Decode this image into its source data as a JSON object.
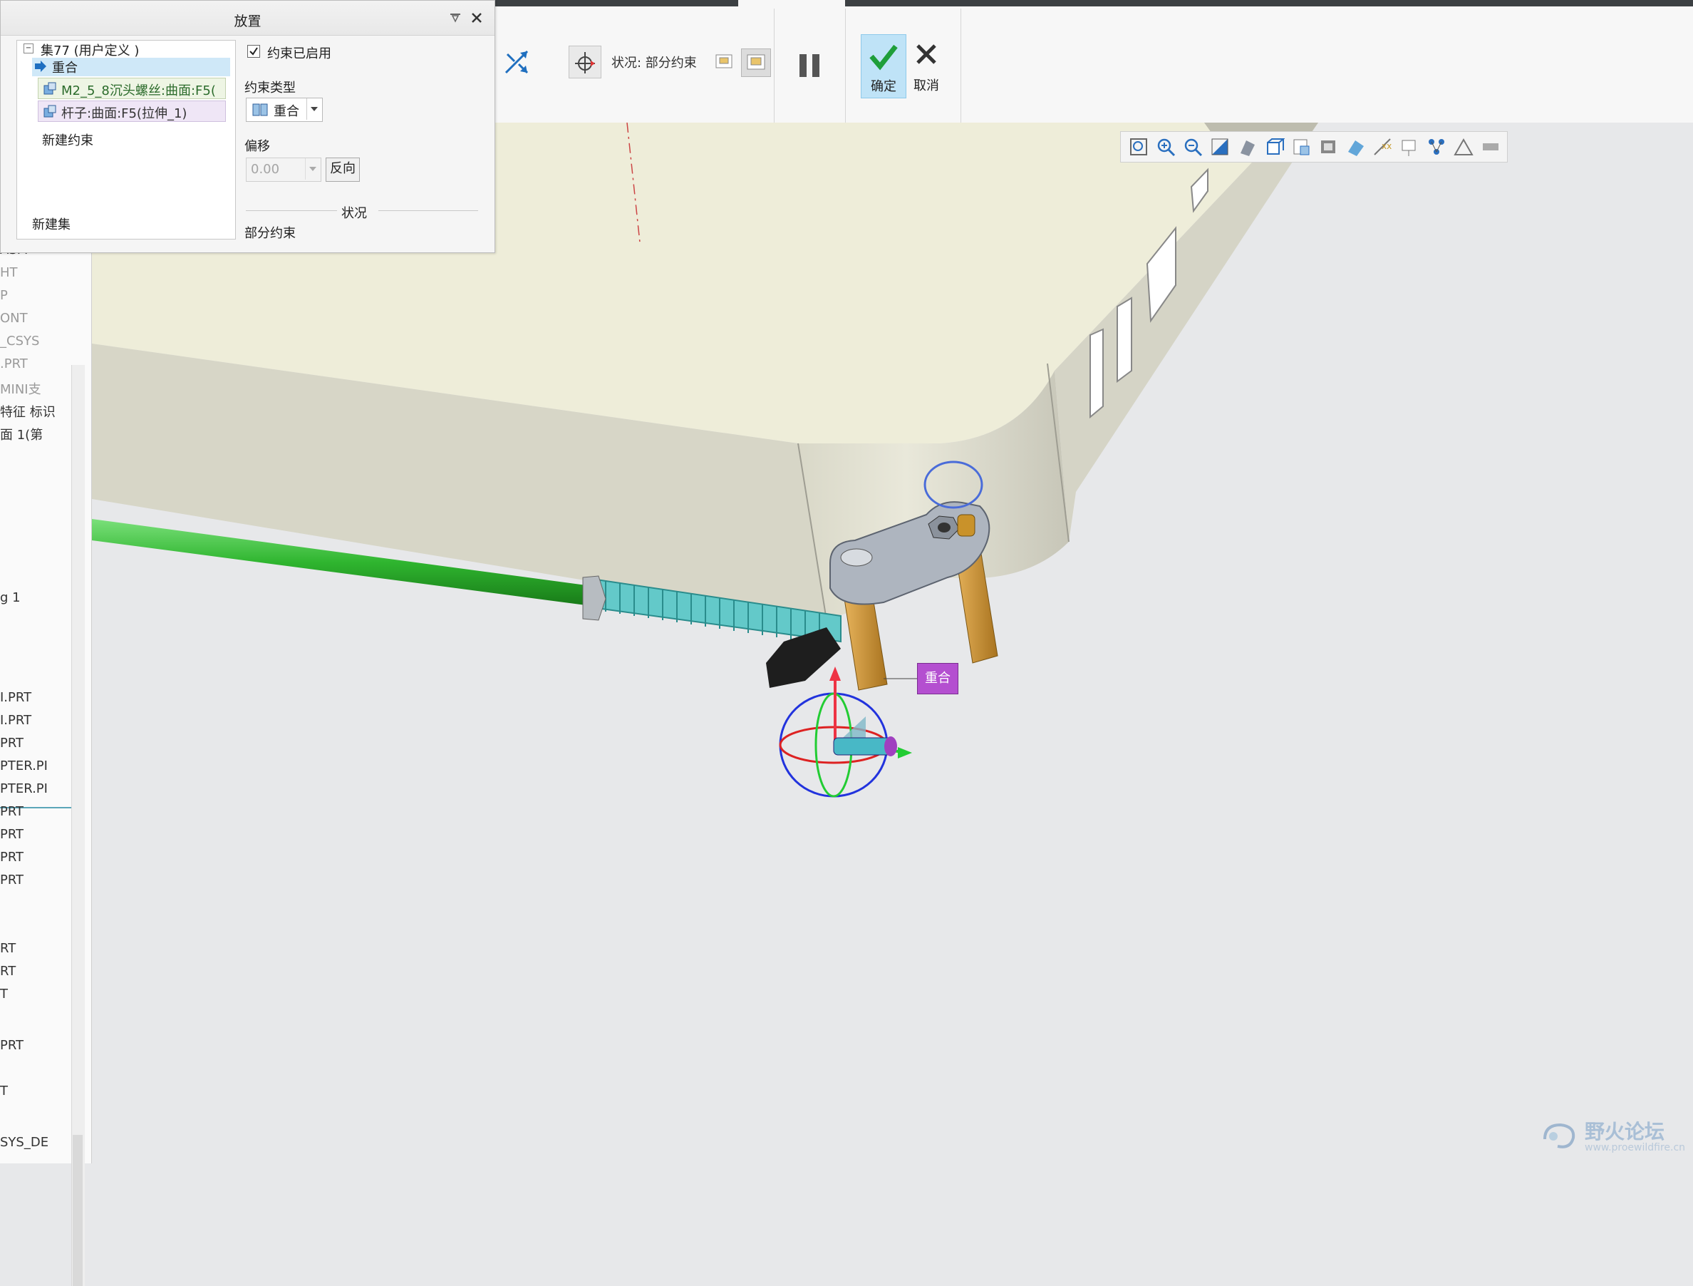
{
  "dialog": {
    "title": "放置",
    "pin_icon": "pin-icon",
    "close_icon": "close-icon",
    "set_label": "集77 (用户定义 )",
    "selected_constraint": "重合",
    "ref1": "M2_5_8沉头螺丝:曲面:F5(",
    "ref2": "杆子:曲面:F5(拉伸_1)",
    "new_constraint": "新建约束",
    "new_set": "新建集",
    "enabled_label": "约束已启用",
    "enabled_checked": true,
    "constraint_type_label": "约束类型",
    "constraint_type_value": "重合",
    "offset_label": "偏移",
    "offset_value": "0.00",
    "flip_button": "反向",
    "status_header": "状况",
    "status_value": "部分约束"
  },
  "ribbon": {
    "status_text": "状况: 部分约束",
    "ok_label": "确定",
    "cancel_label": "取消"
  },
  "tree": {
    "rows": [
      {
        "text": "ASM",
        "dim": false
      },
      {
        "text": "HT",
        "dim": true
      },
      {
        "text": "P",
        "dim": true
      },
      {
        "text": "ONT",
        "dim": true
      },
      {
        "text": "_CSYS",
        "dim": true
      },
      {
        "text": ".PRT",
        "dim": true
      },
      {
        "text": "MINI支",
        "dim": true
      },
      {
        "text": "特征 标识",
        "dim": false
      },
      {
        "text": "面 1(第",
        "dim": false
      },
      {
        "text": "g 1",
        "dim": false
      },
      {
        "text": "I.PRT",
        "dim": false
      },
      {
        "text": "I.PRT",
        "dim": false
      },
      {
        "text": "PRT",
        "dim": false
      },
      {
        "text": "PTER.PI",
        "dim": false
      },
      {
        "text": "PTER.PI",
        "dim": false
      },
      {
        "text": "PRT",
        "dim": false
      },
      {
        "text": "PRT",
        "dim": false
      },
      {
        "text": "PRT",
        "dim": false
      },
      {
        "text": "PRT",
        "dim": false
      },
      {
        "text": "RT",
        "dim": false
      },
      {
        "text": "RT",
        "dim": false
      },
      {
        "text": "T",
        "dim": false
      },
      {
        "text": "PRT",
        "dim": false
      },
      {
        "text": "T",
        "dim": false
      },
      {
        "text": "SYS_DE",
        "dim": false
      }
    ]
  },
  "viewport": {
    "constraint_tag": "重合"
  },
  "watermark": {
    "title": "野火论坛",
    "url": "www.proewildfire.cn"
  },
  "colors": {
    "accent": "#bfe3f7",
    "rod": "#2fb52f",
    "tag": "#b44fd0",
    "body": "#eeedd9"
  }
}
